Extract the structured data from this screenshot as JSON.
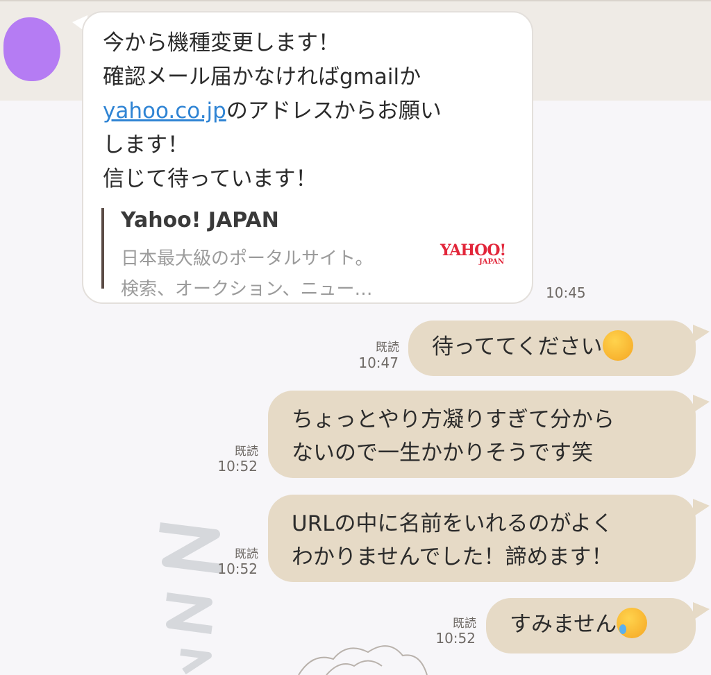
{
  "incoming": {
    "text_before_link": "今から機種変更します！\n確認メール届かなければgmailか\n",
    "link_text": "yahoo.co.jp",
    "text_after_link": "のアドレスからお願い\nします！\n信じて待っています！",
    "time": "10:45",
    "preview": {
      "title": "Yahoo! JAPAN",
      "desc_line1": "日本最大級のポータルサイト。",
      "desc_line2": "検索、オークション、ニュー…",
      "logo_main": "YAHOO!",
      "logo_sub": "JAPAN"
    }
  },
  "outgoing": [
    {
      "text": "待っててください",
      "read": "既読",
      "time": "10:47",
      "emoji": "relieved-face"
    },
    {
      "line1": "ちょっとやり方凝りすぎて分から",
      "line2": "ないので一生かかりそうです笑",
      "read": "既読",
      "time": "10:52"
    },
    {
      "line1": "URLの中に名前をいれるのがよく",
      "line2": "わかりませんでした！諦めます！",
      "read": "既読",
      "time": "10:52"
    },
    {
      "text": "すみません",
      "read": "既読",
      "time": "10:52",
      "emoji": "sad-sweat-face"
    }
  ],
  "colors": {
    "incoming_bubble": "#ffffff",
    "outgoing_bubble": "#e6dac6",
    "link": "#2f84d4",
    "avatar": "#b57cf3",
    "yahoo_red": "#e2263a"
  }
}
